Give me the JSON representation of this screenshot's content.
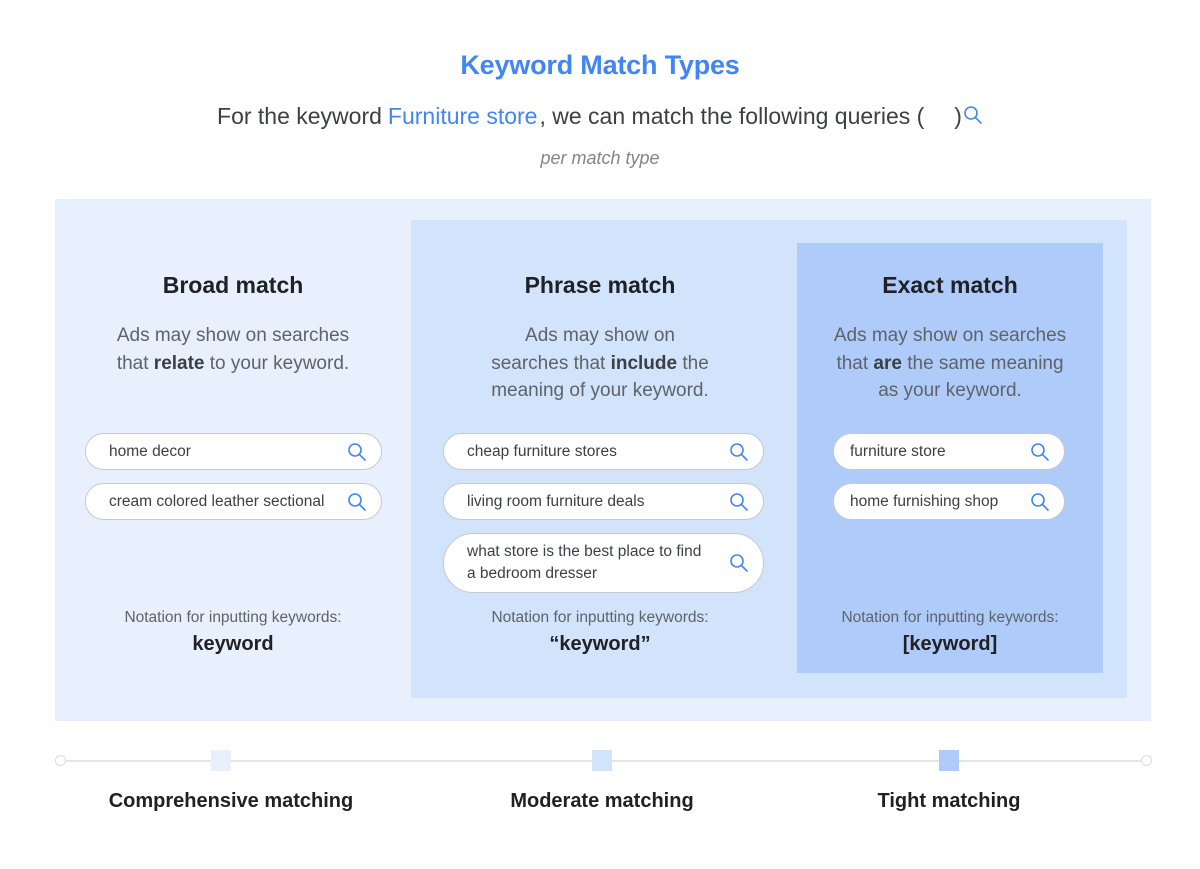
{
  "header": {
    "title": "Keyword Match Types",
    "subtitle_prefix": "For the keyword",
    "subtitle_keyword": "Furniture store",
    "subtitle_suffix": ", we can match the following queries (",
    "subtitle_close": ")",
    "note": "per match type"
  },
  "colors": {
    "accent": "#4285f4",
    "broad_bg": "#e8f0fe",
    "phrase_bg": "#d2e3fc",
    "exact_bg": "#aecbfa"
  },
  "columns": [
    {
      "title": "Broad match",
      "desc_lines": [
        {
          "pre": "Ads may show on searches",
          "bold": "",
          "post": ""
        },
        {
          "pre": "that ",
          "bold": "relate",
          "post": " to your keyword."
        }
      ],
      "queries": [
        "home decor",
        "cream colored leather sectional"
      ],
      "notation_label": "Notation for inputting keywords:",
      "notation": "keyword"
    },
    {
      "title": "Phrase match",
      "desc_lines": [
        {
          "pre": "Ads may show on",
          "bold": "",
          "post": ""
        },
        {
          "pre": "searches that ",
          "bold": "include",
          "post": " the"
        },
        {
          "pre": "meaning of your keyword.",
          "bold": "",
          "post": ""
        }
      ],
      "queries": [
        "cheap furniture stores",
        "living room furniture deals",
        "what store is the best place to find a bedroom dresser"
      ],
      "notation_label": "Notation for inputting keywords:",
      "notation": "“keyword”"
    },
    {
      "title": "Exact match",
      "desc_lines": [
        {
          "pre": "Ads may show on searches",
          "bold": "",
          "post": ""
        },
        {
          "pre": "that ",
          "bold": "are",
          "post": " the same meaning"
        },
        {
          "pre": "as your keyword.",
          "bold": "",
          "post": ""
        }
      ],
      "queries": [
        "furniture store",
        "home furnishing shop"
      ],
      "notation_label": "Notation for inputting keywords:",
      "notation": "[keyword]"
    }
  ],
  "scale": {
    "labels": [
      "Comprehensive matching",
      "Moderate matching",
      "Tight matching"
    ]
  },
  "icons": {
    "search": "search-icon"
  }
}
